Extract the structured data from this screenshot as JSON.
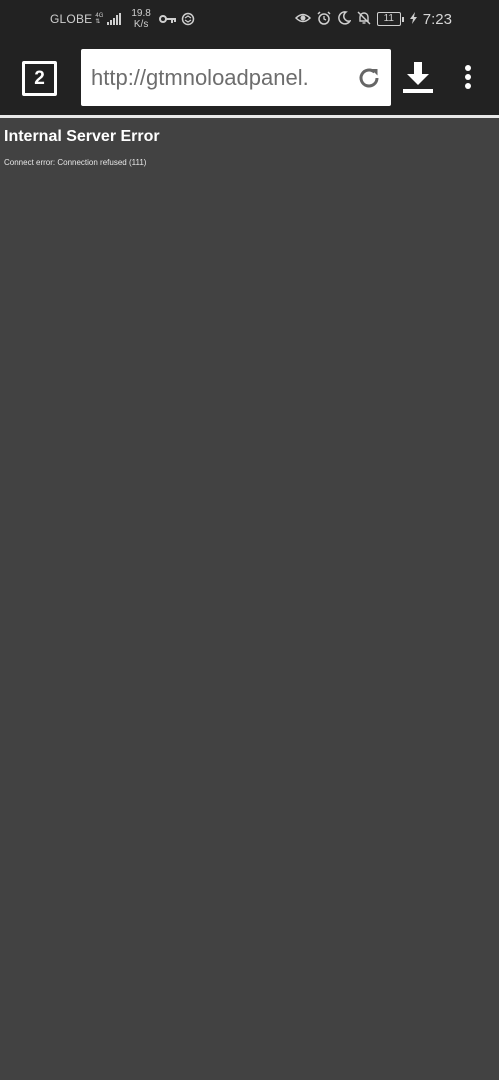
{
  "status_bar": {
    "carrier": "GLOBE",
    "network_type_top": "4G",
    "network_type_bottom": "ᵇ",
    "speed_value": "19.8",
    "speed_unit": "K/s",
    "battery_level": "11",
    "time": "7:23",
    "icons": [
      "signal-icon",
      "vpn-key-icon",
      "sync-icon",
      "eye-comfort-icon",
      "alarm-icon",
      "moon-icon",
      "bell-off-icon",
      "battery-icon",
      "charging-icon"
    ]
  },
  "toolbar": {
    "tab_count": "2",
    "url": "http://gtmnoloadpanel.",
    "icons": [
      "reload-icon",
      "download-icon",
      "menu-icon"
    ]
  },
  "page": {
    "title": "Internal Server Error",
    "message": "Connect error: Connection refused (111)"
  },
  "colors": {
    "background": "#424242",
    "bar": "#222222",
    "text": "#ffffff"
  }
}
